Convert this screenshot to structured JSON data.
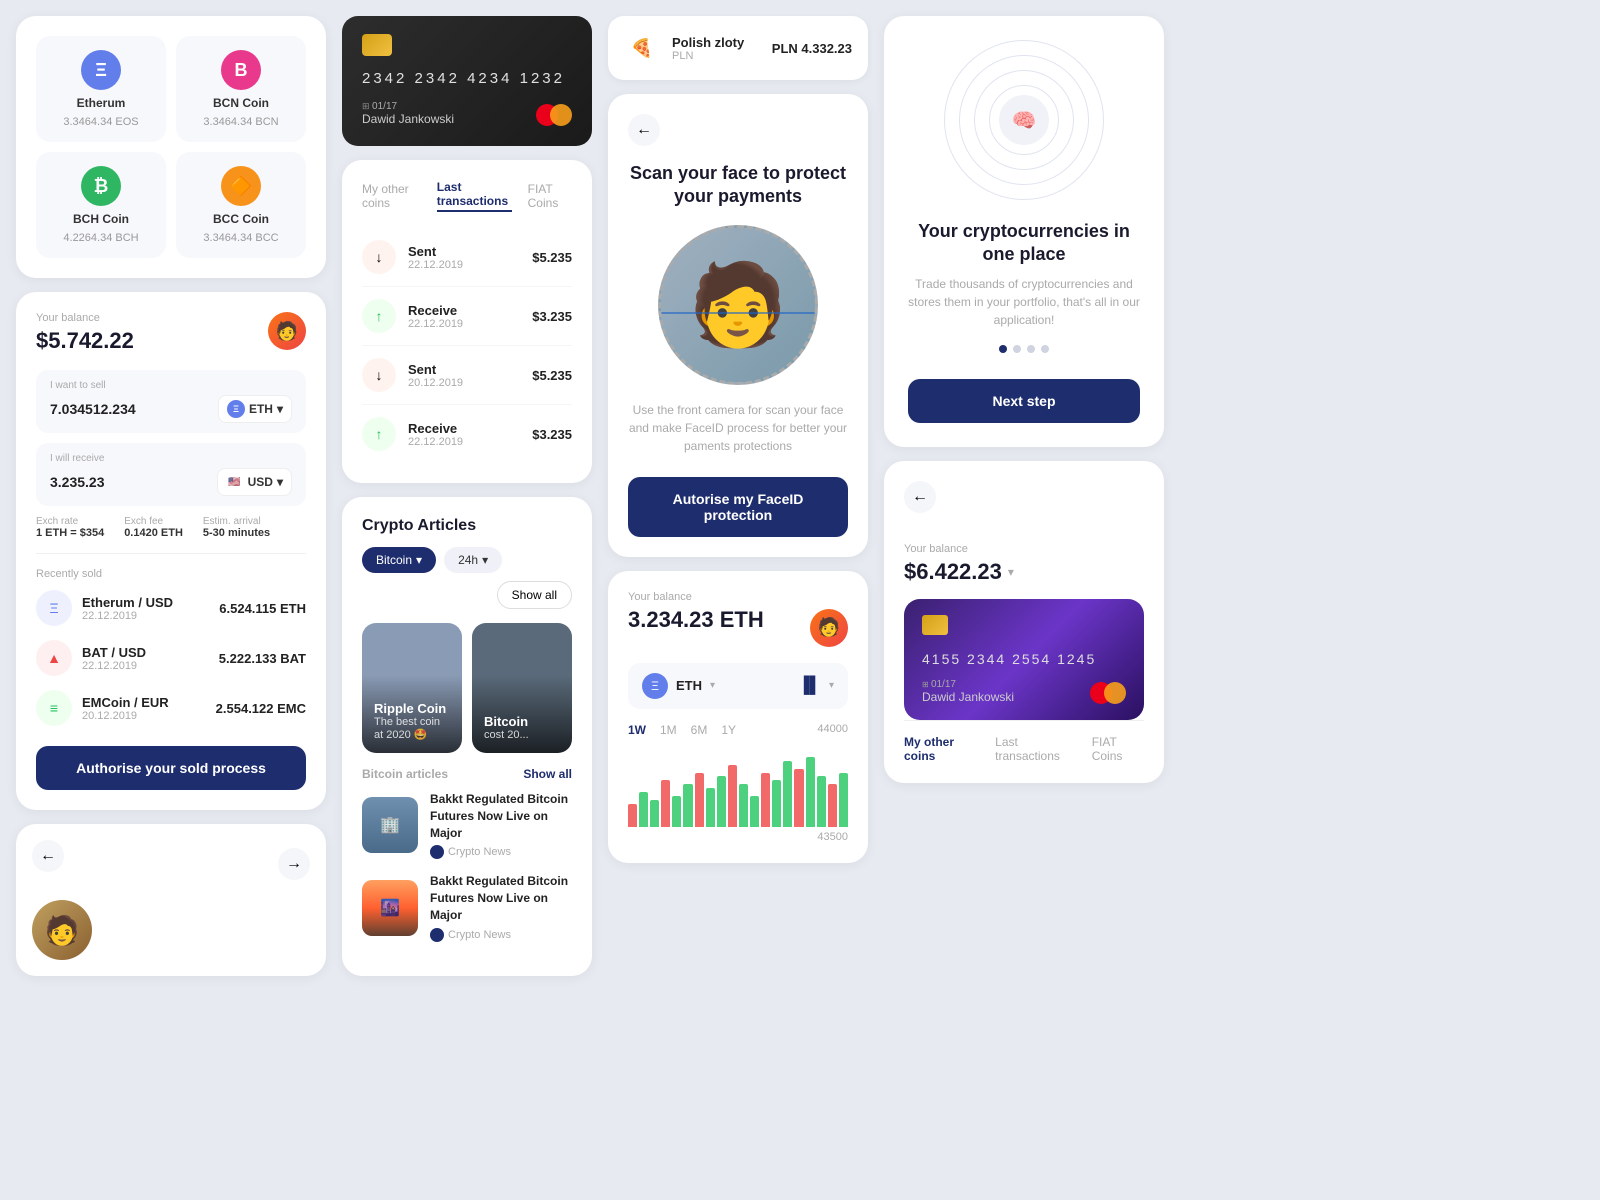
{
  "coins": [
    {
      "id": "etherum",
      "name": "Etherum",
      "amount": "3.3464.34 EOS",
      "color": "#627eea",
      "symbol": "Ξ"
    },
    {
      "id": "bcn",
      "name": "BCN Coin",
      "amount": "3.3464.34 BCN",
      "color": "#e8398d",
      "symbol": "B"
    },
    {
      "id": "bch",
      "name": "BCH Coin",
      "amount": "4.2264.34 BCH",
      "color": "#2fb663",
      "symbol": "₿"
    },
    {
      "id": "bcc",
      "name": "BCC Coin",
      "amount": "3.3464.34 BCC",
      "color": "#f7931a",
      "symbol": "🔶"
    }
  ],
  "balance": {
    "label": "Your balance",
    "amount": "$5.742.22",
    "sell_label": "I want to sell",
    "sell_value": "7.034512.234",
    "sell_currency": "ETH",
    "receive_label": "I will receive",
    "receive_value": "3.235.23",
    "receive_currency": "USD",
    "exch_rate_label": "Exch rate",
    "exch_rate_value": "1 ETH = $354",
    "exch_fee_label": "Exch fee",
    "exch_fee_value": "0.1420 ETH",
    "estim_label": "Estim. arrival",
    "estim_value": "5-30 minutes"
  },
  "recently_sold": {
    "label": "Recently sold",
    "items": [
      {
        "pair": "Etherum / USD",
        "date": "22.12.2019",
        "amount": "6.524.115 ETH",
        "icon": "Ξ",
        "bg": "#627eea"
      },
      {
        "pair": "BAT / USD",
        "date": "22.12.2019",
        "amount": "5.222.133 BAT",
        "icon": "▲",
        "bg": "#ef4444"
      },
      {
        "pair": "EMCoin / EUR",
        "date": "20.12.2019",
        "amount": "2.554.122 EMC",
        "icon": "≡",
        "bg": "#22c55e"
      }
    ]
  },
  "authorise_btn": "Authorise your sold process",
  "credit_card": {
    "number": "2342  2342  4234  1232",
    "expiry": "01/17",
    "holder": "Dawid Jankowski"
  },
  "transactions": {
    "tabs": [
      "My other coins",
      "Last transactions",
      "FIAT Coins"
    ],
    "active_tab": 1,
    "items": [
      {
        "type": "sent",
        "label": "Sent",
        "date": "22.12.2019",
        "amount": "$5.235"
      },
      {
        "type": "recv",
        "label": "Receive",
        "date": "22.12.2019",
        "amount": "$3.235"
      },
      {
        "type": "sent",
        "label": "Sent",
        "date": "20.12.2019",
        "amount": "$5.235"
      },
      {
        "type": "recv",
        "label": "Receive",
        "date": "22.12.2019",
        "amount": "$3.235"
      }
    ]
  },
  "articles": {
    "section_label": "Crypto Articles",
    "filters": [
      "Bitcoin",
      "24h",
      "Show all"
    ],
    "cards": [
      {
        "label": "Ripple Coin",
        "sub": "The best coin at 2020 🤩"
      },
      {
        "label": "Bitcoin",
        "sub": "cost 20..."
      }
    ],
    "bitcoin_articles_label": "Bitcoin articles",
    "show_all": "Show all",
    "list": [
      {
        "title": "Bakkt Regulated Bitcoin Futures Now Live on Major",
        "source": "Crypto News"
      },
      {
        "title": "Bakkt Regulated Bitcoin Futures Now Live on Major",
        "source": "Crypto News"
      }
    ]
  },
  "fiat": {
    "name": "Polish zloty",
    "code": "PLN",
    "amount": "PLN 4.332.23"
  },
  "face_scan": {
    "title": "Scan your face to protect your payments",
    "desc": "Use the front camera for scan your face and make FaceID process for better your paments protections",
    "btn": "Autorise my FaceID protection"
  },
  "eth_balance": {
    "label": "Your balance",
    "amount": "3.234.23 ETH",
    "token": "ETH",
    "time_tabs": [
      "1W",
      "1M",
      "6M",
      "1Y"
    ],
    "active_time": 0,
    "chart_values": [
      30,
      45,
      35,
      60,
      40,
      55,
      70,
      50,
      65,
      80,
      55,
      40,
      70,
      60,
      85,
      75,
      90,
      65,
      55,
      70
    ],
    "chart_label_high": "44000",
    "chart_label_low": "43500"
  },
  "portfolio": {
    "title": "Your cryptocurrencies in one place",
    "desc": "Trade thousands of cryptocurrencies and stores them in your portfolio, that's all in our application!",
    "btn": "Next step",
    "dots": [
      true,
      false,
      false,
      false
    ]
  },
  "right_balance": {
    "label": "Your balance",
    "amount": "$6.422.23",
    "card_number": "4155  2344  2554  1245",
    "expiry": "01/17",
    "holder": "Dawid Jankowski"
  },
  "right_tabs": [
    "My other coins",
    "Last transactions",
    "FIAT Coins"
  ],
  "right_active_tab": 0,
  "small_card": {
    "back": "←",
    "forward": "→"
  }
}
